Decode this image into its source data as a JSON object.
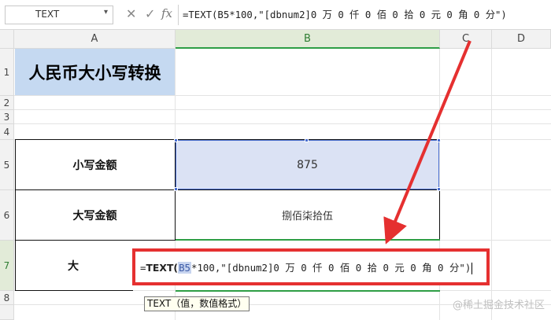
{
  "formula_bar": {
    "name_box": "TEXT",
    "cancel_icon": "✕",
    "confirm_icon": "✓",
    "fx_label": "fx",
    "formula": "=TEXT(B5*100,\"[dbnum2]0 万 0 仟 0 佰 0 拾 0 元 0 角 0 分\")"
  },
  "columns": [
    "A",
    "B",
    "C",
    "D"
  ],
  "rows": [
    "1",
    "2",
    "3",
    "4",
    "5",
    "6",
    "7",
    "8"
  ],
  "cells": {
    "A1": "人民币大小写转换",
    "A5": "小写金额",
    "B5": "875",
    "A6": "大写金额",
    "B6": "捌佰柒拾伍",
    "A7_partial": "大"
  },
  "editor": {
    "prefix": "=",
    "func": "TEXT",
    "open_paren": "(",
    "ref": "B5",
    "rest": "*100,\"[dbnum2]0 万 0 仟 0 佰 0 拾 0 元 0 角 0 分\"",
    "close_paren": ")"
  },
  "tooltip": "TEXT（值，数值格式）",
  "watermark": "@稀土掘金技术社区",
  "colors": {
    "highlight_red": "#e53030",
    "selection_blue": "#4a6fd1",
    "green_active": "#2e9e45",
    "title_fill": "#c5d9f1"
  },
  "icons": [
    "close-icon",
    "check-icon",
    "fx-icon",
    "chevron-down-icon"
  ]
}
